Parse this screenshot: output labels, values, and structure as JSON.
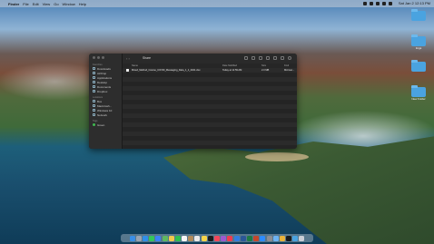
{
  "menubar": {
    "app": "Finder",
    "items": [
      "File",
      "Edit",
      "View",
      "Go",
      "Window",
      "Help"
    ],
    "clock": "Sat Jan 2  12:13 PM"
  },
  "desktop": {
    "items": [
      {
        "label": ""
      },
      {
        "label": "Imgs"
      },
      {
        "label": ""
      },
      {
        "label": "New Folder"
      }
    ]
  },
  "finder": {
    "title": "Share",
    "nav_back": "‹",
    "nav_forward": "›",
    "sidebar": {
      "favorites_header": "Favorites",
      "favorites": [
        "Downloads",
        "AirDrop",
        "Applications",
        "Desktop",
        "Documents",
        "Dropbox"
      ],
      "locations_header": "Locations",
      "locations": [
        "Box",
        "Macintosh...",
        "Windows 10",
        "Network"
      ],
      "tags_header": "Tags",
      "tags": [
        "Green"
      ]
    },
    "columns": {
      "name": "Name",
      "date": "Date Modified",
      "size": "Size",
      "kind": "Kind"
    },
    "files": [
      {
        "name": "Mixed_Method_Course_COVID_Messaging_Data_1_1_2021.xlsx",
        "date": "Today at 11:59 AM",
        "size": "2.3 MB",
        "kind": "Microso..."
      }
    ]
  },
  "dock": {
    "apps": [
      {
        "name": "finder",
        "color": "#3a8ee6"
      },
      {
        "name": "launchpad",
        "color": "#9aa4b1"
      },
      {
        "name": "safari",
        "color": "#2f8fe8"
      },
      {
        "name": "messages",
        "color": "#34c759"
      },
      {
        "name": "mail",
        "color": "#3b82f6"
      },
      {
        "name": "maps",
        "color": "#5fb85f"
      },
      {
        "name": "photos",
        "color": "#f2c94c"
      },
      {
        "name": "facetime",
        "color": "#2fbf4f"
      },
      {
        "name": "calendar",
        "color": "#f5f5f5"
      },
      {
        "name": "contacts",
        "color": "#b08a5a"
      },
      {
        "name": "reminders",
        "color": "#eaeaea"
      },
      {
        "name": "notes",
        "color": "#f7d54a"
      },
      {
        "name": "tv",
        "color": "#1c1c1c"
      },
      {
        "name": "music",
        "color": "#f2475b"
      },
      {
        "name": "podcasts",
        "color": "#9b59d0"
      },
      {
        "name": "news",
        "color": "#ef3b4f"
      },
      {
        "name": "app-store",
        "color": "#2f7de1"
      },
      {
        "name": "word",
        "color": "#2b5797"
      },
      {
        "name": "excel",
        "color": "#1f7a44"
      },
      {
        "name": "powerpoint",
        "color": "#c4462b"
      },
      {
        "name": "zoom",
        "color": "#2d8cff"
      },
      {
        "name": "system-preferences",
        "color": "#8e8e93"
      },
      {
        "name": "preview",
        "color": "#6db3f2"
      },
      {
        "name": "chrome",
        "color": "#e8b23a"
      },
      {
        "name": "terminal",
        "color": "#1a1a1a"
      },
      {
        "name": "downloads",
        "color": "#4aa3e0"
      },
      {
        "name": "trash",
        "color": "#c9ced6"
      }
    ]
  }
}
